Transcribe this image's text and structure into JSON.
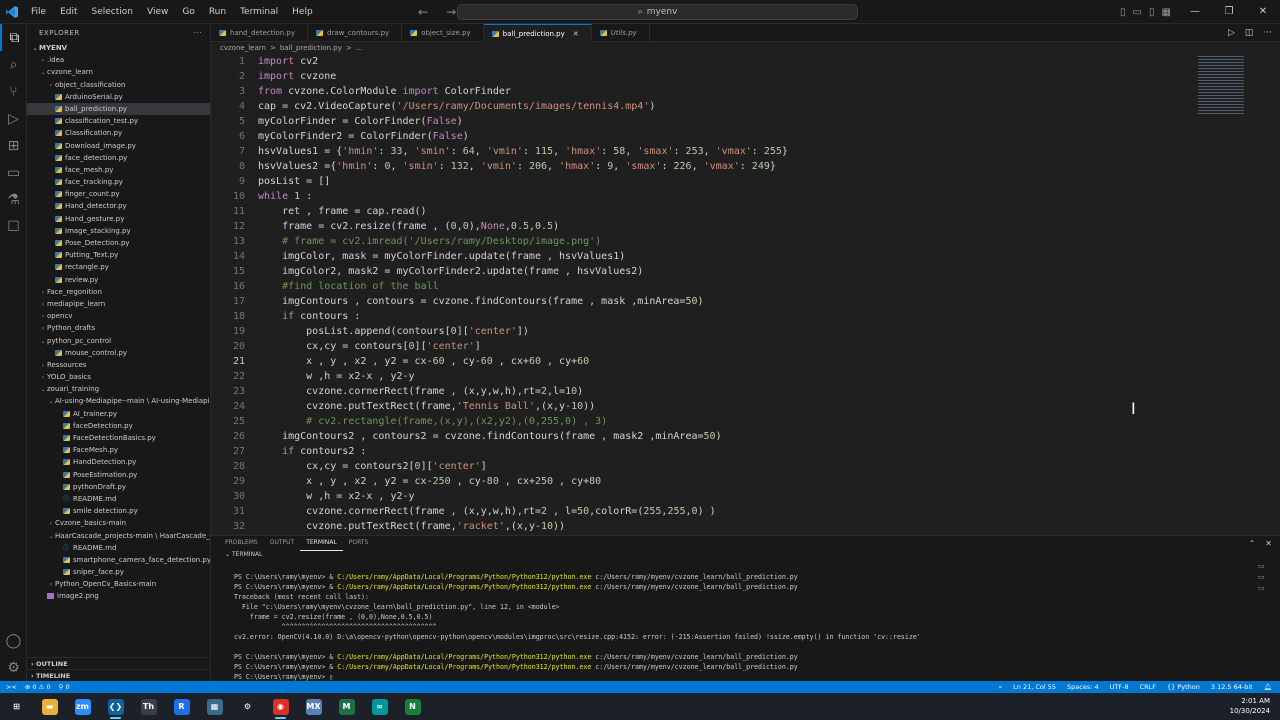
{
  "titlebar": {
    "menu": [
      "File",
      "Edit",
      "Selection",
      "View",
      "Go",
      "Run",
      "Terminal",
      "Help"
    ],
    "search_text": "myenv",
    "window_controls": [
      "—",
      "❐",
      "✕"
    ]
  },
  "sidebar": {
    "title": "EXPLORER",
    "items": [
      {
        "label": "MYENV",
        "depth": 0,
        "type": "folder-open",
        "bold": true
      },
      {
        "label": ".idea",
        "depth": 1,
        "type": "folder"
      },
      {
        "label": "cvzone_learn",
        "depth": 1,
        "type": "folder-open"
      },
      {
        "label": "object_classification",
        "depth": 2,
        "type": "folder"
      },
      {
        "label": "ArduinoSerial.py",
        "depth": 2,
        "type": "py"
      },
      {
        "label": "ball_prediction.py",
        "depth": 2,
        "type": "py",
        "selected": true
      },
      {
        "label": "classification_test.py",
        "depth": 2,
        "type": "py"
      },
      {
        "label": "Classification.py",
        "depth": 2,
        "type": "py"
      },
      {
        "label": "Download_image.py",
        "depth": 2,
        "type": "py"
      },
      {
        "label": "face_detection.py",
        "depth": 2,
        "type": "py"
      },
      {
        "label": "face_mesh.py",
        "depth": 2,
        "type": "py"
      },
      {
        "label": "face_tracking.py",
        "depth": 2,
        "type": "py"
      },
      {
        "label": "finger_count.py",
        "depth": 2,
        "type": "py"
      },
      {
        "label": "Hand_detector.py",
        "depth": 2,
        "type": "py"
      },
      {
        "label": "Hand_gesture.py",
        "depth": 2,
        "type": "py"
      },
      {
        "label": "Image_stacking.py",
        "depth": 2,
        "type": "py"
      },
      {
        "label": "Pose_Detection.py",
        "depth": 2,
        "type": "py"
      },
      {
        "label": "Putting_Text.py",
        "depth": 2,
        "type": "py"
      },
      {
        "label": "rectangle.py",
        "depth": 2,
        "type": "py"
      },
      {
        "label": "review.py",
        "depth": 2,
        "type": "py"
      },
      {
        "label": "Face_regonition",
        "depth": 1,
        "type": "folder"
      },
      {
        "label": "mediapipe_learn",
        "depth": 1,
        "type": "folder"
      },
      {
        "label": "opencv",
        "depth": 1,
        "type": "folder"
      },
      {
        "label": "Python_drafts",
        "depth": 1,
        "type": "folder"
      },
      {
        "label": "python_pc_control",
        "depth": 1,
        "type": "folder-open"
      },
      {
        "label": "mouse_control.py",
        "depth": 2,
        "type": "py"
      },
      {
        "label": "Ressources",
        "depth": 1,
        "type": "folder"
      },
      {
        "label": "YOLO_basics",
        "depth": 1,
        "type": "folder"
      },
      {
        "label": "zouari_training",
        "depth": 1,
        "type": "folder-open"
      },
      {
        "label": "AI-using-Mediapipe--main \\ AI-using-Mediapipe...",
        "depth": 2,
        "type": "folder-open"
      },
      {
        "label": "AI_trainer.py",
        "depth": 3,
        "type": "py"
      },
      {
        "label": "faceDetection.py",
        "depth": 3,
        "type": "py"
      },
      {
        "label": "FaceDetectionBasics.py",
        "depth": 3,
        "type": "py"
      },
      {
        "label": "FaceMesh.py",
        "depth": 3,
        "type": "py"
      },
      {
        "label": "HandDetection.py",
        "depth": 3,
        "type": "py"
      },
      {
        "label": "PoseEstimation.py",
        "depth": 3,
        "type": "py"
      },
      {
        "label": "pythonDraft.py",
        "depth": 3,
        "type": "py"
      },
      {
        "label": "README.md",
        "depth": 3,
        "type": "md"
      },
      {
        "label": "smile detection.py",
        "depth": 3,
        "type": "py"
      },
      {
        "label": "Cvzone_basics-main",
        "depth": 2,
        "type": "folder"
      },
      {
        "label": "HaarCascade_projects-main \\ HaarCascade_proje...",
        "depth": 2,
        "type": "folder-open"
      },
      {
        "label": "README.md",
        "depth": 3,
        "type": "md"
      },
      {
        "label": "smartphone_camera_face_detection.py",
        "depth": 3,
        "type": "py"
      },
      {
        "label": "sniper_face.py",
        "depth": 3,
        "type": "py"
      },
      {
        "label": "Python_OpenCv_Basics-main",
        "depth": 2,
        "type": "folder"
      },
      {
        "label": "image2.png",
        "depth": 1,
        "type": "img"
      }
    ],
    "outline": "OUTLINE",
    "timeline": "TIMELINE"
  },
  "tabs": [
    {
      "label": "hand_detection.py",
      "active": false
    },
    {
      "label": "draw_contours.py",
      "active": false
    },
    {
      "label": "object_size.py",
      "active": false
    },
    {
      "label": "ball_prediction.py",
      "active": true
    },
    {
      "label": "Utils.py",
      "active": false,
      "italic": true
    }
  ],
  "breadcrumb": [
    "cvzone_learn",
    ">",
    "ball_prediction.py",
    ">",
    "..."
  ],
  "code": {
    "current_line": 21,
    "lines": [
      "<span class=\"kw\">import</span> cv2",
      "<span class=\"kw\">import</span> cvzone",
      "<span class=\"kw\">from</span> cvzone.ColorModule <span class=\"kw\">import</span> ColorFinder",
      "cap = cv2.VideoCapture(<span class=\"str\">'/Users/ramy/Documents/images/tennis4.mp4'</span>)",
      "myColorFinder = ColorFinder(<span class=\"kw\">False</span>)",
      "myColorFinder2 = ColorFinder(<span class=\"kw\">False</span>)",
      "hsvValues1 = {<span class=\"str\">'hmin'</span>: <span class=\"num\">33</span>, <span class=\"str\">'smin'</span>: <span class=\"num\">64</span>, <span class=\"str\">'vmin'</span>: <span class=\"num\">115</span>, <span class=\"str\">'hmax'</span>: <span class=\"num\">58</span>, <span class=\"str\">'smax'</span>: <span class=\"num\">253</span>, <span class=\"str\">'vmax'</span>: <span class=\"num\">255</span>}",
      "hsvValues2 ={<span class=\"str\">'hmin'</span>: <span class=\"num\">0</span>, <span class=\"str\">'smin'</span>: <span class=\"num\">132</span>, <span class=\"str\">'vmin'</span>: <span class=\"num\">206</span>, <span class=\"str\">'hmax'</span>: <span class=\"num\">9</span>, <span class=\"str\">'smax'</span>: <span class=\"num\">226</span>, <span class=\"str\">'vmax'</span>: <span class=\"num\">249</span>}",
      "posList = []",
      "<span class=\"kw\">while</span> <span class=\"num\">1</span> :",
      "    ret , frame = cap.read()",
      "    frame = cv2.resize(frame , (<span class=\"num\">0</span>,<span class=\"num\">0</span>),<span class=\"kw\">None</span>,<span class=\"num\">0.5</span>,<span class=\"num\">0.5</span>)",
      "    <span class=\"cm\"># frame = cv2.imread('/Users/ramy/Desktop/image.png')</span>",
      "    imgColor, mask = myColorFinder.update(frame , hsvValues1)",
      "    imgColor2, mask2 = myColorFinder2.update(frame , hsvValues2)",
      "    <span class=\"cm\">#find location of the ball</span>",
      "    imgContours , contours = cvzone.findContours(frame , mask ,minArea=<span class=\"num\">50</span>)",
      "    <span class=\"kw\">if</span> contours :",
      "        posList.append(contours[<span class=\"num\">0</span>][<span class=\"str\">'center'</span>])",
      "        cx,cy = contours[<span class=\"num\">0</span>][<span class=\"str\">'center'</span>]",
      "        x , y , x2 , y2 = cx-<span class=\"num\">60</span> , cy-<span class=\"num\">60</span> , cx+<span class=\"num\">60</span> , cy+<span class=\"num\">60</span>",
      "        w ,h = x2-x , y2-y",
      "        cvzone.cornerRect(frame , (x,y,w,h),rt=<span class=\"num\">2</span>,l=<span class=\"num\">10</span>)",
      "        cvzone.putTextRect(frame,<span class=\"str\">'Tennis Ball'</span>,(x,y-<span class=\"num\">10</span>))",
      "        <span class=\"cm\"># cv2.rectangle(frame,(x,y),(x2,y2),(0,255,0) , 3)</span>",
      "    imgContours2 , contours2 = cvzone.findContours(frame , mask2 ,minArea=<span class=\"num\">50</span>)",
      "    <span class=\"kw\">if</span> contours2 :",
      "        cx,cy = contours2[<span class=\"num\">0</span>][<span class=\"str\">'center'</span>]",
      "        x , y , x2 , y2 = cx-<span class=\"num\">250</span> , cy-<span class=\"num\">80</span> , cx+<span class=\"num\">250</span> , cy+<span class=\"num\">80</span>",
      "        w ,h = x2-x , y2-y",
      "        cvzone.cornerRect(frame , (x,y,w,h),rt=<span class=\"num\">2</span> , l=<span class=\"num\">50</span>,colorR=(<span class=\"num\">255</span>,<span class=\"num\">255</span>,<span class=\"num\">0</span>) )",
      "        cvzone.putTextRect(frame,<span class=\"str\">'racket'</span>,(x,y-<span class=\"num\">10</span>))"
    ]
  },
  "panel": {
    "tabs": [
      "PROBLEMS",
      "OUTPUT",
      "TERMINAL",
      "PORTS"
    ],
    "active_tab": "TERMINAL",
    "terminal_label": "TERMINAL",
    "terminal_lines": [
      "PS C:\\Users\\ramy\\myenv> & <span class=\"y\">C:/Users/ramy/AppData/Local/Programs/Python/Python312/python.exe</span> c:/Users/ramy/myenv/cvzone_learn/ball_prediction.py",
      "PS C:\\Users\\ramy\\myenv> & <span class=\"y\">C:/Users/ramy/AppData/Local/Programs/Python/Python312/python.exe</span> c:/Users/ramy/myenv/cvzone_learn/ball_prediction.py",
      "Traceback (most recent call last):",
      "  File \"c:\\Users\\ramy\\myenv\\cvzone_learn\\ball_prediction.py\", line 12, in &lt;module&gt;",
      "    frame = cv2.resize(frame , (0,0),None,0.5,0.5)",
      "            ^^^^^^^^^^^^^^^^^^^^^^^^^^^^^^^^^^^^^^^",
      "cv2.error: OpenCV(4.10.0) D:\\a\\opencv-python\\opencv-python\\opencv\\modules\\imgproc\\src\\resize.cpp:4152: error: (-215:Assertion failed) !ssize.empty() in function 'cv::resize'",
      "",
      "PS C:\\Users\\ramy\\myenv> & <span class=\"y\">C:/Users/ramy/AppData/Local/Programs/Python/Python312/python.exe</span> c:/Users/ramy/myenv/cvzone_learn/ball_prediction.py",
      "PS C:\\Users\\ramy\\myenv> & <span class=\"y\">C:/Users/ramy/AppData/Local/Programs/Python/Python312/python.exe</span> c:/Users/ramy/myenv/cvzone_learn/ball_prediction.py",
      "PS C:\\Users\\ramy\\myenv> ▯"
    ]
  },
  "statusbar": {
    "remote": "><",
    "problems": "⊗ 0 ⚠ 0",
    "ports": "⚲ 0",
    "cursor": "Ln 21, Col 55",
    "spaces": "Spaces: 4",
    "encoding": "UTF-8",
    "eol": "CRLF",
    "language": "{} Python",
    "interpreter": "3.12.5 64-bit"
  },
  "taskbar": {
    "apps": [
      {
        "name": "start",
        "glyph": "⊞",
        "color": "#1c2029"
      },
      {
        "name": "file-explorer",
        "glyph": "▬",
        "color": "#e8b13a"
      },
      {
        "name": "zoom",
        "glyph": "zm",
        "color": "#2d8cff"
      },
      {
        "name": "vscode",
        "glyph": "❮❯",
        "color": "#0e639c",
        "active": true
      },
      {
        "name": "thonny",
        "glyph": "Th",
        "color": "#3a3f4b"
      },
      {
        "name": "vs-blue",
        "glyph": "R",
        "color": "#1f6feb"
      },
      {
        "name": "tool",
        "glyph": "▦",
        "color": "#3b6a8f"
      },
      {
        "name": "settings",
        "glyph": "⚙",
        "color": "#1c2029"
      },
      {
        "name": "chrome",
        "glyph": "◉",
        "color": "#d93025",
        "active": true
      },
      {
        "name": "mx",
        "glyph": "MX",
        "color": "#5a7fb5"
      },
      {
        "name": "excel-like",
        "glyph": "M",
        "color": "#1e7145"
      },
      {
        "name": "arduino",
        "glyph": "∞",
        "color": "#00979c"
      },
      {
        "name": "n-app",
        "glyph": "N",
        "color": "#1a7f37"
      }
    ],
    "time": "2:01 AM",
    "date": "10/30/2024"
  }
}
